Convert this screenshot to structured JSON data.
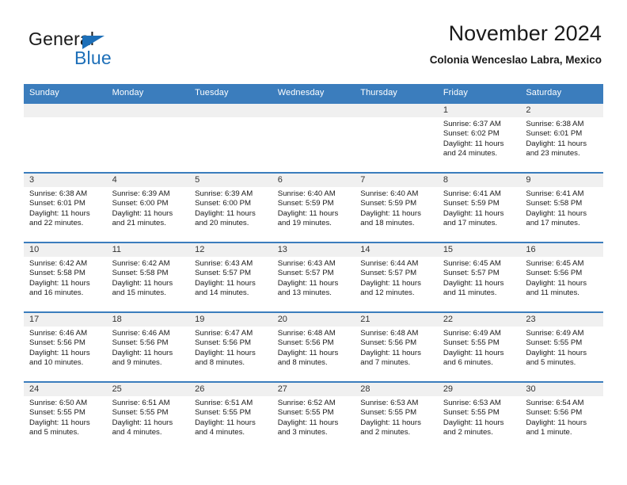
{
  "brand": {
    "name_part1": "General",
    "name_part2": "Blue",
    "accent_color": "#1d6fb8"
  },
  "header": {
    "title": "November 2024",
    "subtitle": "Colonia Wenceslao Labra, Mexico"
  },
  "calendar": {
    "header_bg": "#3b7dbd",
    "daynum_bg": "#f0f0f0",
    "weekday_headers": [
      "Sunday",
      "Monday",
      "Tuesday",
      "Wednesday",
      "Thursday",
      "Friday",
      "Saturday"
    ],
    "weeks": [
      [
        {
          "day": "",
          "lines": []
        },
        {
          "day": "",
          "lines": []
        },
        {
          "day": "",
          "lines": []
        },
        {
          "day": "",
          "lines": []
        },
        {
          "day": "",
          "lines": []
        },
        {
          "day": "1",
          "lines": [
            "Sunrise: 6:37 AM",
            "Sunset: 6:02 PM",
            "Daylight: 11 hours",
            "and 24 minutes."
          ]
        },
        {
          "day": "2",
          "lines": [
            "Sunrise: 6:38 AM",
            "Sunset: 6:01 PM",
            "Daylight: 11 hours",
            "and 23 minutes."
          ]
        }
      ],
      [
        {
          "day": "3",
          "lines": [
            "Sunrise: 6:38 AM",
            "Sunset: 6:01 PM",
            "Daylight: 11 hours",
            "and 22 minutes."
          ]
        },
        {
          "day": "4",
          "lines": [
            "Sunrise: 6:39 AM",
            "Sunset: 6:00 PM",
            "Daylight: 11 hours",
            "and 21 minutes."
          ]
        },
        {
          "day": "5",
          "lines": [
            "Sunrise: 6:39 AM",
            "Sunset: 6:00 PM",
            "Daylight: 11 hours",
            "and 20 minutes."
          ]
        },
        {
          "day": "6",
          "lines": [
            "Sunrise: 6:40 AM",
            "Sunset: 5:59 PM",
            "Daylight: 11 hours",
            "and 19 minutes."
          ]
        },
        {
          "day": "7",
          "lines": [
            "Sunrise: 6:40 AM",
            "Sunset: 5:59 PM",
            "Daylight: 11 hours",
            "and 18 minutes."
          ]
        },
        {
          "day": "8",
          "lines": [
            "Sunrise: 6:41 AM",
            "Sunset: 5:59 PM",
            "Daylight: 11 hours",
            "and 17 minutes."
          ]
        },
        {
          "day": "9",
          "lines": [
            "Sunrise: 6:41 AM",
            "Sunset: 5:58 PM",
            "Daylight: 11 hours",
            "and 17 minutes."
          ]
        }
      ],
      [
        {
          "day": "10",
          "lines": [
            "Sunrise: 6:42 AM",
            "Sunset: 5:58 PM",
            "Daylight: 11 hours",
            "and 16 minutes."
          ]
        },
        {
          "day": "11",
          "lines": [
            "Sunrise: 6:42 AM",
            "Sunset: 5:58 PM",
            "Daylight: 11 hours",
            "and 15 minutes."
          ]
        },
        {
          "day": "12",
          "lines": [
            "Sunrise: 6:43 AM",
            "Sunset: 5:57 PM",
            "Daylight: 11 hours",
            "and 14 minutes."
          ]
        },
        {
          "day": "13",
          "lines": [
            "Sunrise: 6:43 AM",
            "Sunset: 5:57 PM",
            "Daylight: 11 hours",
            "and 13 minutes."
          ]
        },
        {
          "day": "14",
          "lines": [
            "Sunrise: 6:44 AM",
            "Sunset: 5:57 PM",
            "Daylight: 11 hours",
            "and 12 minutes."
          ]
        },
        {
          "day": "15",
          "lines": [
            "Sunrise: 6:45 AM",
            "Sunset: 5:57 PM",
            "Daylight: 11 hours",
            "and 11 minutes."
          ]
        },
        {
          "day": "16",
          "lines": [
            "Sunrise: 6:45 AM",
            "Sunset: 5:56 PM",
            "Daylight: 11 hours",
            "and 11 minutes."
          ]
        }
      ],
      [
        {
          "day": "17",
          "lines": [
            "Sunrise: 6:46 AM",
            "Sunset: 5:56 PM",
            "Daylight: 11 hours",
            "and 10 minutes."
          ]
        },
        {
          "day": "18",
          "lines": [
            "Sunrise: 6:46 AM",
            "Sunset: 5:56 PM",
            "Daylight: 11 hours",
            "and 9 minutes."
          ]
        },
        {
          "day": "19",
          "lines": [
            "Sunrise: 6:47 AM",
            "Sunset: 5:56 PM",
            "Daylight: 11 hours",
            "and 8 minutes."
          ]
        },
        {
          "day": "20",
          "lines": [
            "Sunrise: 6:48 AM",
            "Sunset: 5:56 PM",
            "Daylight: 11 hours",
            "and 8 minutes."
          ]
        },
        {
          "day": "21",
          "lines": [
            "Sunrise: 6:48 AM",
            "Sunset: 5:56 PM",
            "Daylight: 11 hours",
            "and 7 minutes."
          ]
        },
        {
          "day": "22",
          "lines": [
            "Sunrise: 6:49 AM",
            "Sunset: 5:55 PM",
            "Daylight: 11 hours",
            "and 6 minutes."
          ]
        },
        {
          "day": "23",
          "lines": [
            "Sunrise: 6:49 AM",
            "Sunset: 5:55 PM",
            "Daylight: 11 hours",
            "and 5 minutes."
          ]
        }
      ],
      [
        {
          "day": "24",
          "lines": [
            "Sunrise: 6:50 AM",
            "Sunset: 5:55 PM",
            "Daylight: 11 hours",
            "and 5 minutes."
          ]
        },
        {
          "day": "25",
          "lines": [
            "Sunrise: 6:51 AM",
            "Sunset: 5:55 PM",
            "Daylight: 11 hours",
            "and 4 minutes."
          ]
        },
        {
          "day": "26",
          "lines": [
            "Sunrise: 6:51 AM",
            "Sunset: 5:55 PM",
            "Daylight: 11 hours",
            "and 4 minutes."
          ]
        },
        {
          "day": "27",
          "lines": [
            "Sunrise: 6:52 AM",
            "Sunset: 5:55 PM",
            "Daylight: 11 hours",
            "and 3 minutes."
          ]
        },
        {
          "day": "28",
          "lines": [
            "Sunrise: 6:53 AM",
            "Sunset: 5:55 PM",
            "Daylight: 11 hours",
            "and 2 minutes."
          ]
        },
        {
          "day": "29",
          "lines": [
            "Sunrise: 6:53 AM",
            "Sunset: 5:55 PM",
            "Daylight: 11 hours",
            "and 2 minutes."
          ]
        },
        {
          "day": "30",
          "lines": [
            "Sunrise: 6:54 AM",
            "Sunset: 5:56 PM",
            "Daylight: 11 hours",
            "and 1 minute."
          ]
        }
      ]
    ]
  }
}
